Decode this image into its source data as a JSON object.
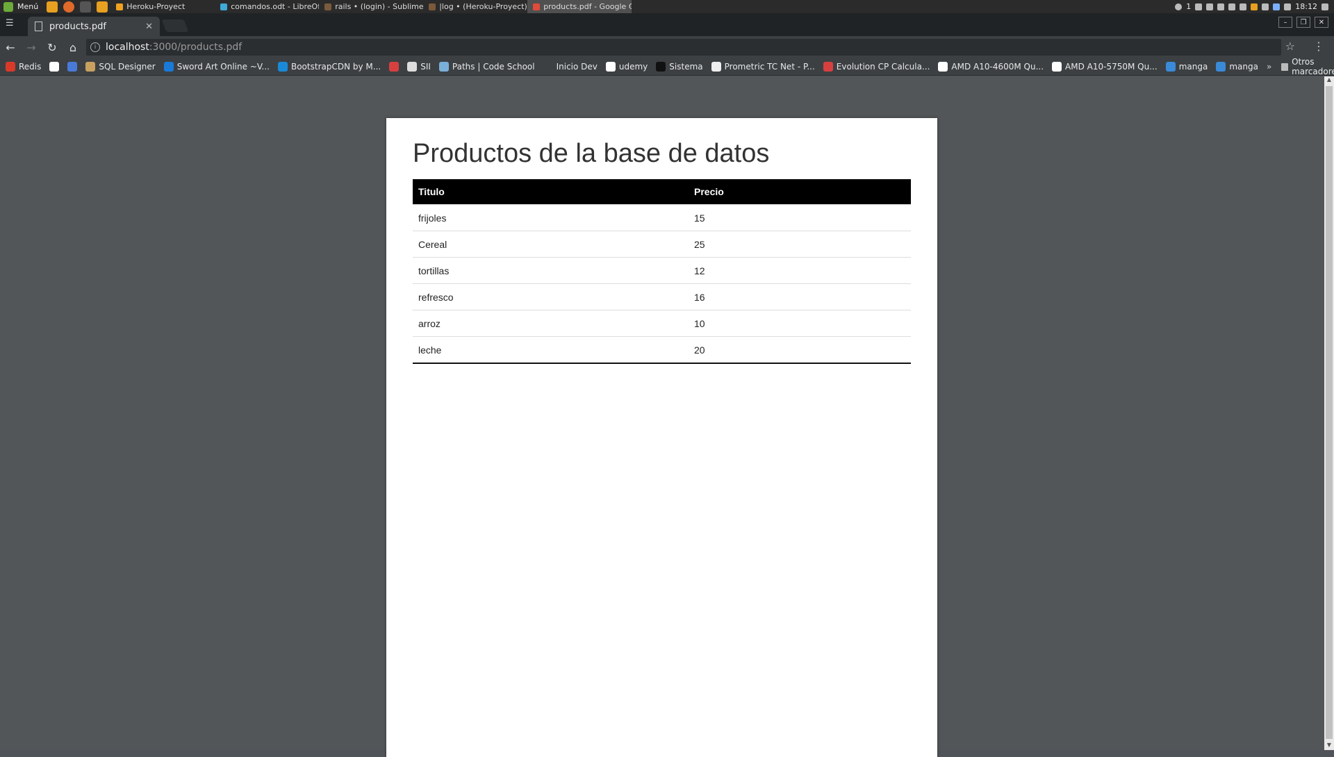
{
  "os_panel": {
    "menu_label": "Menú",
    "tasks": [
      {
        "label": "Heroku-Proyect",
        "color": "#f0a020"
      },
      {
        "label": "comandos.odt - LibreOffi...",
        "color": "#3fa9d8"
      },
      {
        "label": "rails • (login) - Sublime T...",
        "color": "#7a5a3a"
      },
      {
        "label": "|log • (Heroku-Proyect) - ...",
        "color": "#7a5a3a"
      },
      {
        "label": "products.pdf - Google Ch...",
        "color": "#e04a3a"
      }
    ],
    "workspace": "1",
    "clock": "18:12"
  },
  "browser": {
    "tab_title": "products.pdf",
    "url_host": "localhost",
    "url_path": ":3000/products.pdf",
    "bookmarks": [
      {
        "label": "Redis",
        "color": "#d83a2a"
      },
      {
        "label": "",
        "color": "#ffffff"
      },
      {
        "label": "",
        "color": "#4a7ad8"
      },
      {
        "label": "SQL Designer",
        "color": "#c8a060"
      },
      {
        "label": "Sword Art Online ~V...",
        "color": "#1a7ad8"
      },
      {
        "label": "BootstrapCDN by M...",
        "color": "#1a8ad8"
      },
      {
        "label": "",
        "color": "#d84040"
      },
      {
        "label": "SII",
        "color": "#dddddd"
      },
      {
        "label": "Paths | Code School",
        "color": "#7ab0d8"
      },
      {
        "label": "Inicio Dev",
        "color": "#3c4043"
      },
      {
        "label": "udemy",
        "color": "#ffffff"
      },
      {
        "label": "Sistema",
        "color": "#111111"
      },
      {
        "label": "Prometric TC Net - P...",
        "color": "#eeeeee"
      },
      {
        "label": "Evolution CP Calcula...",
        "color": "#d84040"
      },
      {
        "label": "AMD A10-4600M Qu...",
        "color": "#ffffff"
      },
      {
        "label": "AMD A10-5750M Qu...",
        "color": "#ffffff"
      },
      {
        "label": "manga",
        "color": "#3a8ad8"
      },
      {
        "label": "manga",
        "color": "#3a8ad8"
      }
    ],
    "more_label": "»",
    "other_bookmarks": "Otros marcadores"
  },
  "document": {
    "heading": "Productos de la base de datos",
    "columns": [
      "Titulo",
      "Precio"
    ],
    "rows": [
      [
        "frijoles",
        "15"
      ],
      [
        "Cereal",
        "25"
      ],
      [
        "tortillas",
        "12"
      ],
      [
        "refresco",
        "16"
      ],
      [
        "arroz",
        "10"
      ],
      [
        "leche",
        "20"
      ]
    ]
  }
}
